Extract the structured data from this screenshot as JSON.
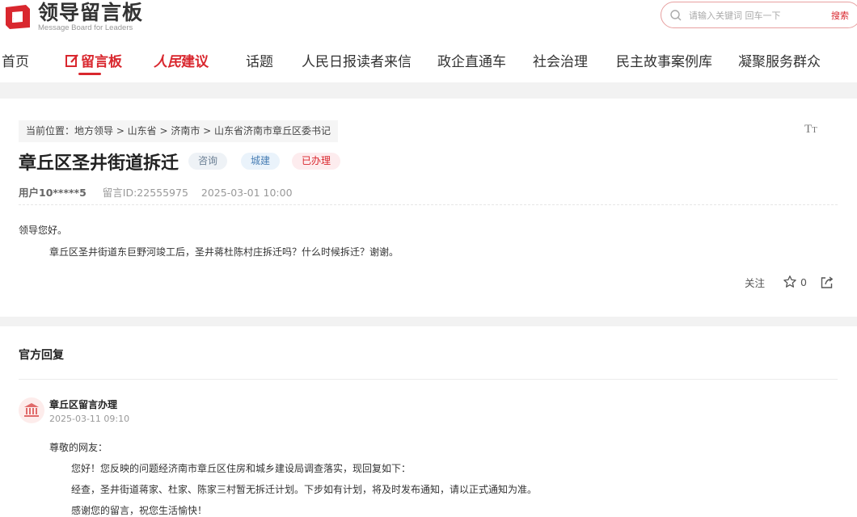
{
  "header": {
    "logo_title": "领导留言板",
    "logo_subtitle": "Message Board for Leaders",
    "search_placeholder": "请输入关键词 回车一下",
    "search_button": "搜索"
  },
  "nav": {
    "items": [
      "首页",
      "留言板",
      "人民建议",
      "话题",
      "人民日报读者来信",
      "政企直通车",
      "社会治理",
      "民主故事案例库",
      "凝聚服务群众"
    ],
    "active": "留言板",
    "rmjy_part1": "人民",
    "rmjy_part2": "建议"
  },
  "message": {
    "breadcrumb": "当前位置：地方领导 > 山东省 > 济南市 > 山东省济南市章丘区委书记",
    "font_toggle": "TT",
    "title": "章丘区圣井街道拆迁",
    "tags": [
      "咨询",
      "城建",
      "已办理"
    ],
    "user": "用户10*****5",
    "message_id": "留言ID:22555975",
    "datetime": "2025-03-01 10:00",
    "greeting": "领导您好。",
    "body": "章丘区圣井街道东巨野河竣工后，圣井蒋杜陈村庄拆迁吗？什么时候拆迁？谢谢。",
    "follow_label": "关注",
    "star_count": "0"
  },
  "reply": {
    "heading": "官方回复",
    "org_name": "章丘区留言办理",
    "time": "2025-03-11 09:10",
    "lines": [
      "尊敬的网友：",
      "您好！您反映的问题经济南市章丘区住房和城乡建设局调查落实，现回复如下：",
      "经查，圣井街道蒋家、杜家、陈家三村暂无拆迁计划。下步如有计划，将及时发布通知，请以正式通知为准。",
      "感谢您的留言，祝您生活愉快！"
    ]
  },
  "colors": {
    "brand_red": "#d9272e",
    "tag_consult": "#6b7f94",
    "tag_urban": "#4a7fb5",
    "tag_done": "#d9272e"
  },
  "icons": [
    "logo-icon",
    "search-icon",
    "message-board-icon",
    "font-size-icon",
    "star-icon",
    "share-icon",
    "government-building-icon"
  ]
}
